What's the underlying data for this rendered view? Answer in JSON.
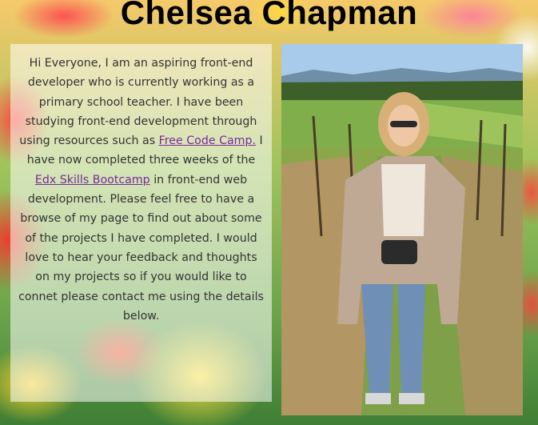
{
  "header": {
    "title": "Chelsea Chapman"
  },
  "bio": {
    "text_1": "Hi Everyone, I am an aspiring front-end developer who is currently working as a primary school teacher. I have been studying front-end development through using resources such as ",
    "link_1": "Free Code Camp.",
    "text_2": " I have now completed three weeks of the ",
    "link_2": "Edx Skills Bootcamp",
    "text_3": " in front-end web development. Please feel free to have a browse of my page to find out about some of the projects I have completed. I would love to hear your feedback and thoughts on my projects so if you would like to connet please contact me using the details below."
  },
  "colors": {
    "title": "#000000",
    "link": "#7a2a9c",
    "text": "#333333"
  }
}
